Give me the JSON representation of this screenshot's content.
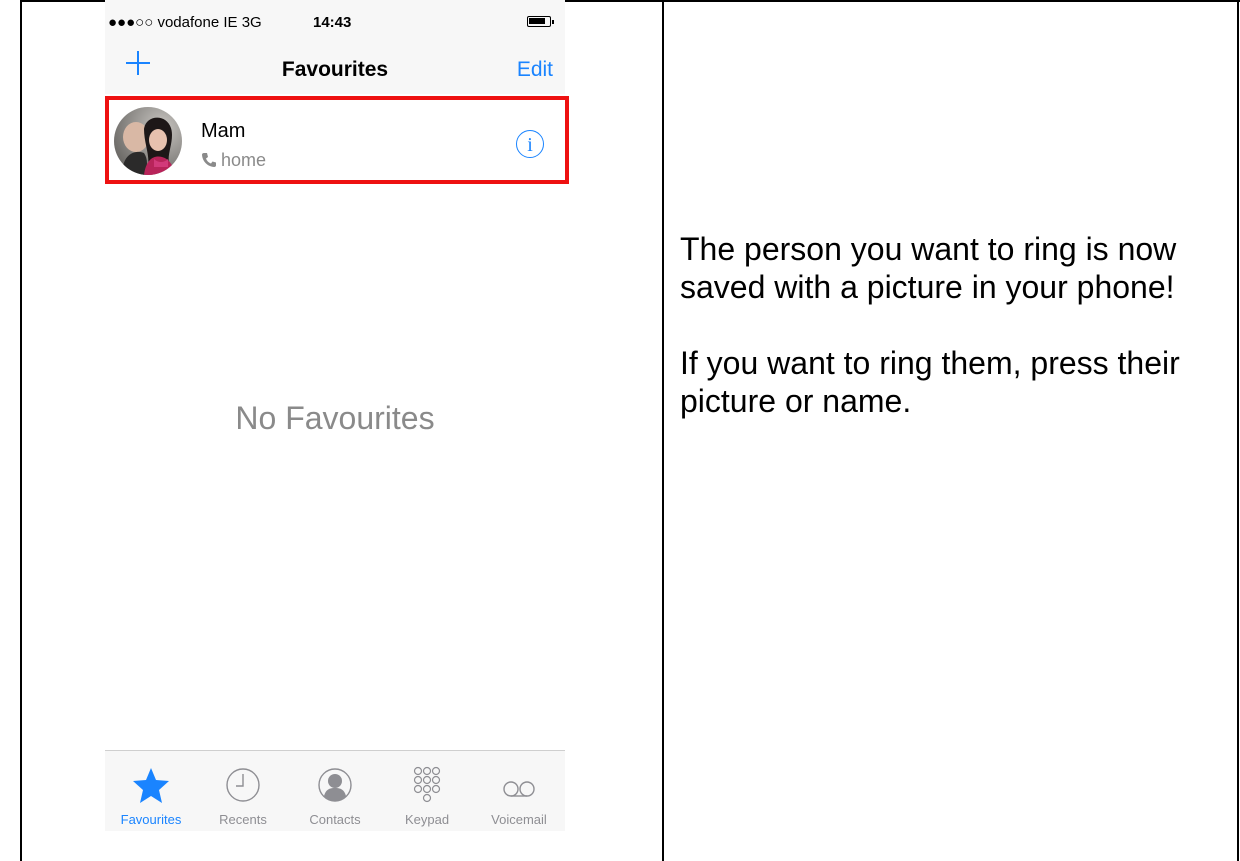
{
  "status_bar": {
    "carrier": "●●●○○ vodafone IE  3G",
    "time": "14:43"
  },
  "nav": {
    "title": "Favourites",
    "add_icon": "plus-icon",
    "edit_label": "Edit"
  },
  "favourite": {
    "name": "Mam",
    "type": "home"
  },
  "empty_state": "No Favourites",
  "tabs": [
    {
      "label": "Favourites",
      "icon": "star-icon",
      "active": true
    },
    {
      "label": "Recents",
      "icon": "clock-icon",
      "active": false
    },
    {
      "label": "Contacts",
      "icon": "person-icon",
      "active": false
    },
    {
      "label": "Keypad",
      "icon": "keypad-icon",
      "active": false
    },
    {
      "label": "Voicemail",
      "icon": "voicemail-icon",
      "active": false
    }
  ],
  "instructions": {
    "para1": "The person you want to ring is now saved with a picture in your phone!",
    "para2": "If you want to ring them, press their picture or name."
  },
  "colors": {
    "accent": "#1a84ff",
    "highlight": "#ee1111"
  }
}
